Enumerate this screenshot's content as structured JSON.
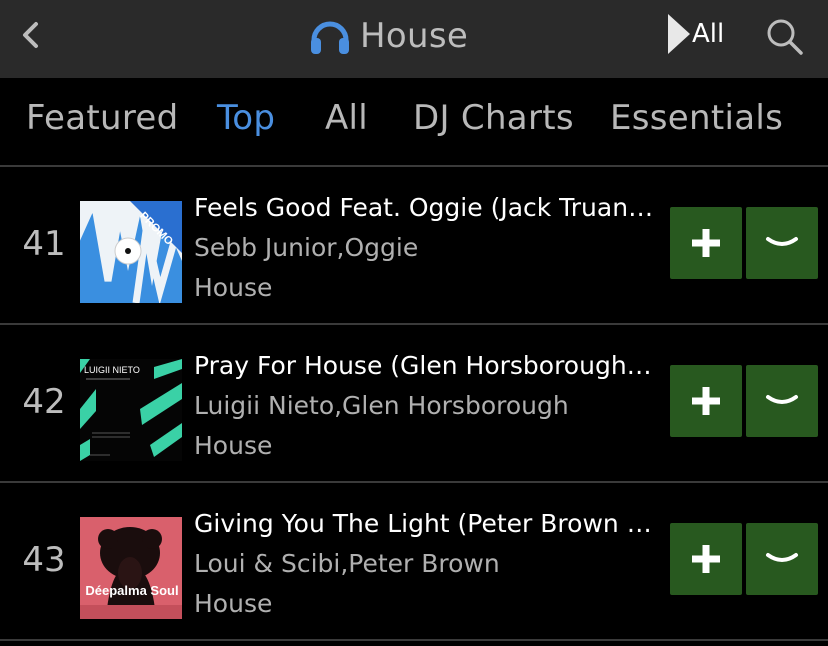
{
  "header": {
    "title": "House",
    "all_label": "All"
  },
  "tabs": [
    {
      "label": "Featured",
      "active": false
    },
    {
      "label": "Top",
      "active": true
    },
    {
      "label": "All",
      "active": false
    },
    {
      "label": "DJ Charts",
      "active": false
    },
    {
      "label": "Essentials",
      "active": false
    }
  ],
  "tracks": [
    {
      "rank": "41",
      "title": "Feels Good Feat. Oggie (Jack Truant Extended Remix)",
      "artists": "Sebb Junior,Oggie",
      "genre": "House",
      "badge": "PROMO"
    },
    {
      "rank": "42",
      "title": "Pray For House (Glen Horsborough Extended Remix)",
      "artists": "Luigii Nieto,Glen Horsborough",
      "genre": "House",
      "cover_text": "LUIGII NIETO"
    },
    {
      "rank": "43",
      "title": "Giving You The Light (Peter Brown Extended Remix)",
      "artists": "Loui & Scibi,Peter Brown",
      "genre": "House",
      "cover_text": "Déepalma Soul"
    }
  ],
  "colors": {
    "accent": "#4a8fe0",
    "button_green": "#28591f",
    "topbar_bg": "#2a2a2a"
  },
  "icons": {
    "back": "chevron-left-icon",
    "logo": "headphones-icon",
    "play": "play-triangle-icon",
    "search": "search-icon",
    "add": "plus-icon",
    "more": "chevron-down-icon"
  }
}
